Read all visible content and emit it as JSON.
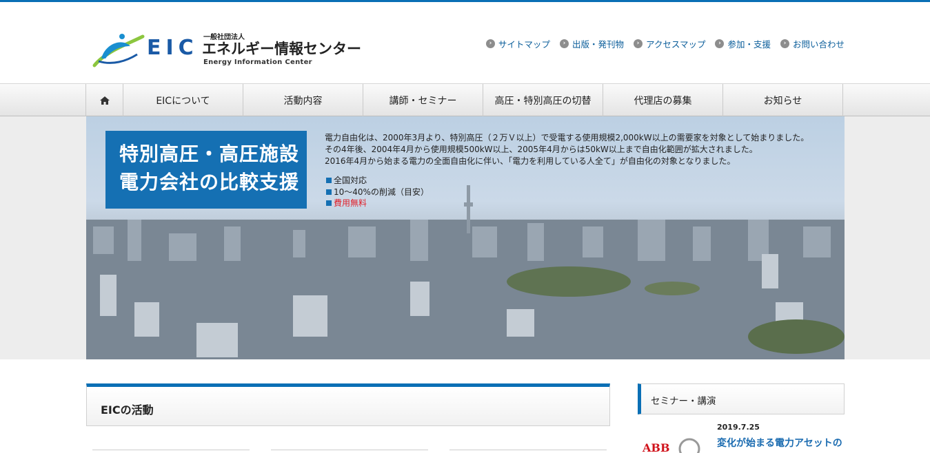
{
  "header": {
    "logo_mark": "EIC",
    "logo_corp": "一般社団法人",
    "logo_name": "エネルギー情報センター",
    "logo_en": "Energy Information Center"
  },
  "utility_links": [
    {
      "label": "サイトマップ"
    },
    {
      "label": "出版・発刊物"
    },
    {
      "label": "アクセスマップ"
    },
    {
      "label": "参加・支援"
    },
    {
      "label": "お問い合わせ"
    }
  ],
  "nav": {
    "home_icon": "home-icon",
    "items": [
      {
        "label": "EICについて"
      },
      {
        "label": "活動内容"
      },
      {
        "label": "講師・セミナー"
      },
      {
        "label": "高圧・特別高圧の切替"
      },
      {
        "label": "代理店の募集"
      },
      {
        "label": "お知らせ"
      }
    ]
  },
  "hero": {
    "title_line1": "特別高圧・高圧施設",
    "title_line2": "電力会社の比較支援",
    "text": [
      "電力自由化は、2000年3月より、特別高圧（２万Ｖ以上）で受電する使用規模2,000kW以上の需要家を対象として始まりました。",
      "その4年後、2004年4月から使用規模500kW以上、2005年4月からは50kW以上まで自由化範囲が拡大されました。",
      "2016年4月から始まる電力の全面自由化に伴い、「電力を利用している人全て」が自由化の対象となりました。"
    ],
    "points": [
      {
        "label": "全国対応"
      },
      {
        "label": "10～40%の削減（目安）"
      },
      {
        "label": "費用無料"
      }
    ]
  },
  "main_section": {
    "title": "EICの活動"
  },
  "sidebar": {
    "heading": "セミナー・講演",
    "news": {
      "date": "2019.7.25",
      "title": "変化が始まる電力アセットの",
      "thumb_text": "ABB"
    }
  },
  "colors": {
    "accent": "#0a6fb5",
    "link": "#0a5d9a",
    "highlight": "#e0202a"
  }
}
